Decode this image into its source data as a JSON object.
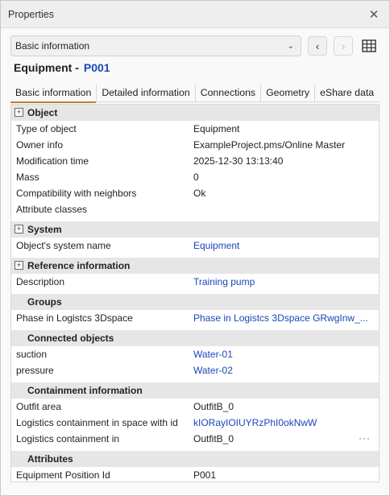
{
  "window": {
    "title": "Properties",
    "close_icon": "close-icon"
  },
  "toolbar": {
    "view_selected": "Basic information",
    "back_icon": "‹",
    "forward_icon": "›",
    "grid_icon": "table-icon"
  },
  "heading": {
    "type": "Equipment -",
    "id": "P001"
  },
  "tabs": [
    {
      "label": "Basic information",
      "active": true
    },
    {
      "label": "Detailed information",
      "active": false
    },
    {
      "label": "Connections",
      "active": false
    },
    {
      "label": "Geometry",
      "active": false
    },
    {
      "label": "eShare data",
      "active": false
    }
  ],
  "sections": {
    "object": {
      "title": "Object",
      "rows": [
        {
          "key": "Type of object",
          "value": "Equipment"
        },
        {
          "key": "Owner info",
          "value": "ExampleProject.pms/Online Master"
        },
        {
          "key": "Modification time",
          "value": "2025-12-30 13:13:40"
        },
        {
          "key": "Mass",
          "value": "0"
        },
        {
          "key": "Compatibility with neighbors",
          "value": "Ok"
        },
        {
          "key": "Attribute classes",
          "value": ""
        }
      ]
    },
    "system": {
      "title": "System",
      "rows": [
        {
          "key": "Object's system name",
          "value": "Equipment"
        }
      ]
    },
    "reference": {
      "title": "Reference information",
      "rows": [
        {
          "key": "Description",
          "value": "Training pump"
        }
      ]
    },
    "groups": {
      "title": "Groups",
      "rows": [
        {
          "key": "Phase in Logistcs 3Dspace",
          "value": "Phase in Logistcs 3Dspace GRwgInw_..."
        }
      ]
    },
    "connected": {
      "title": "Connected objects",
      "rows": [
        {
          "key": "suction",
          "value": "Water-01"
        },
        {
          "key": "pressure",
          "value": "Water-02"
        }
      ]
    },
    "containment": {
      "title": "Containment information",
      "rows": [
        {
          "key": "Outfit area",
          "value": "OutfitB_0"
        },
        {
          "key": "Logistics containment in space with id",
          "value": "kIORayIOIUYRzPhI0okNwW"
        },
        {
          "key": "Logistics containment in",
          "value": "OutfitB_0"
        }
      ],
      "more": "···"
    },
    "attributes": {
      "title": "Attributes",
      "rows": [
        {
          "key": "Equipment Position Id",
          "value": "P001"
        }
      ]
    }
  },
  "colors": {
    "link": "#1947b8",
    "tab_underline": "#c07f2d",
    "section_bg": "#e6e6e6"
  }
}
